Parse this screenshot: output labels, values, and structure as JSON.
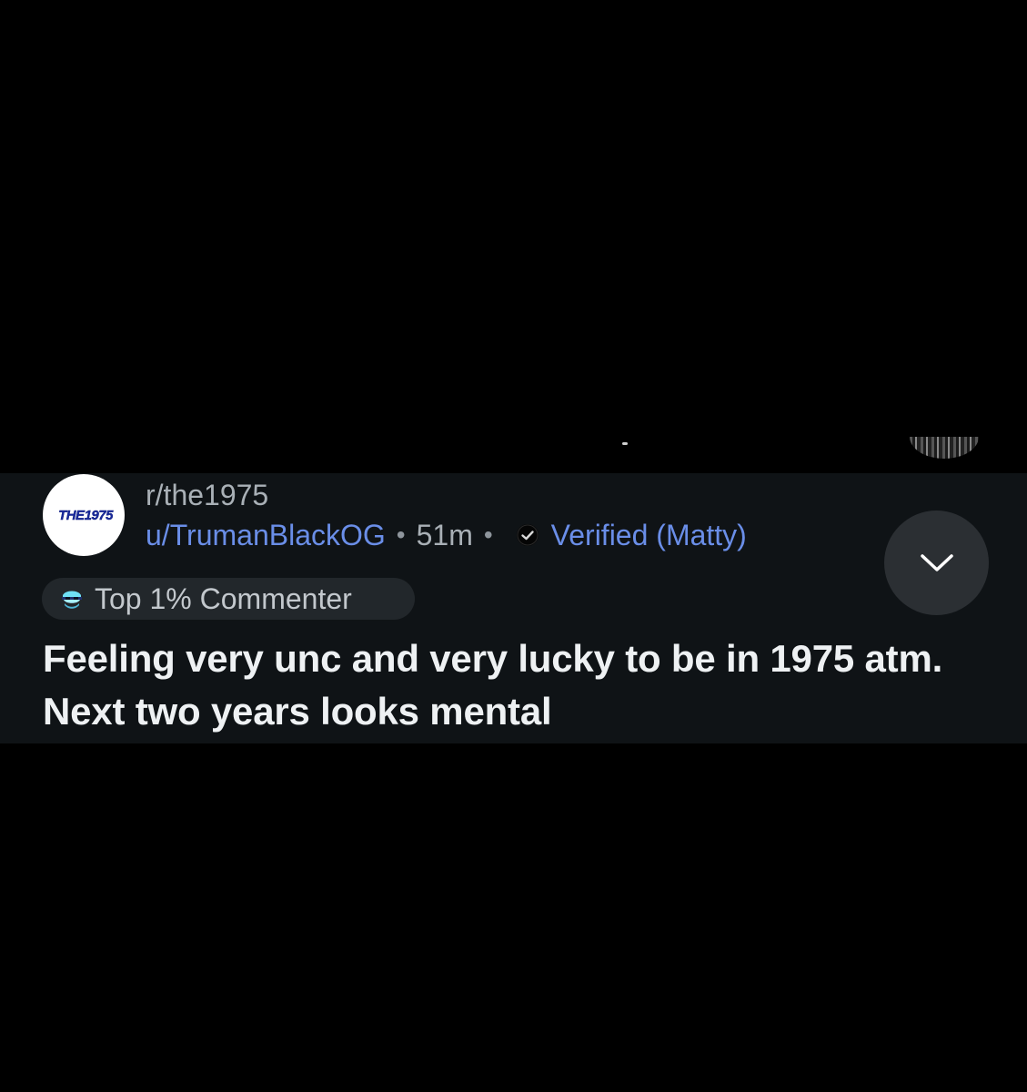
{
  "comment": {
    "avatar": {
      "logo_text": "THE1975"
    },
    "subreddit": "r/the1975",
    "username": "u/TrumanBlackOG",
    "separator": "•",
    "time": "51m",
    "verified_label": "Verified (Matty)",
    "flair": {
      "label": "Top 1% Commenter",
      "icon": "top-commenter-icon"
    },
    "body": "Feeling very unc and very lucky to be in 1975 atm. Next two years looks mental",
    "collapse_icon": "chevron-down-icon"
  },
  "colors": {
    "page_background": "#000000",
    "card_background": "#0f1316",
    "link_blue": "#6a8ee8",
    "muted_text": "#a9b0b6",
    "body_text": "#eef1f3",
    "flair_background": "#22272b",
    "collapse_button_background": "#2b2f33"
  }
}
